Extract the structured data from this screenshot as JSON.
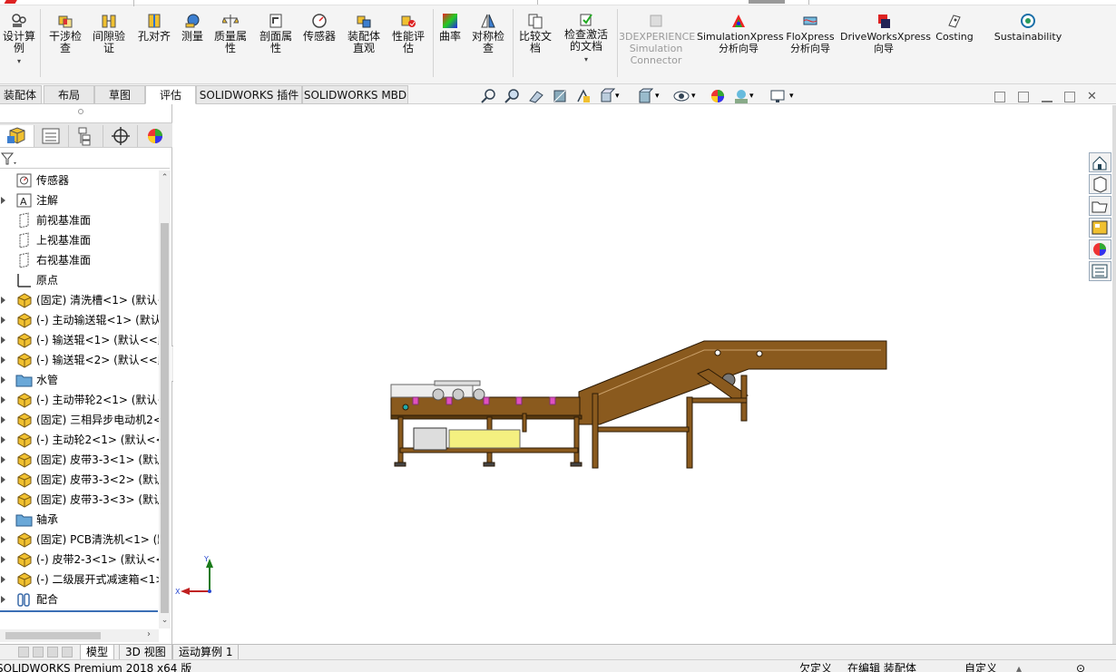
{
  "ribbon": {
    "buttons": [
      {
        "label": "设计算例",
        "icon": "design-study-icon"
      },
      {
        "label": "干涉检查",
        "icon": "interference-detection-icon"
      },
      {
        "label": "间隙验证",
        "icon": "clearance-verification-icon"
      },
      {
        "label": "孔对齐",
        "icon": "hole-alignment-icon"
      },
      {
        "label": "测量",
        "icon": "measure-icon"
      },
      {
        "label": "质量属性",
        "icon": "mass-properties-icon"
      },
      {
        "label": "剖面属性",
        "icon": "section-properties-icon"
      },
      {
        "label": "传感器",
        "icon": "sensor-icon"
      },
      {
        "label": "装配体直观",
        "icon": "assembly-visualization-icon"
      },
      {
        "label": "性能评估",
        "icon": "performance-evaluation-icon"
      },
      {
        "label": "曲率",
        "icon": "curvature-icon"
      },
      {
        "label": "对称检查",
        "icon": "symmetry-check-icon"
      },
      {
        "label": "比较文档",
        "icon": "compare-documents-icon"
      },
      {
        "label": "检查激活的文档",
        "icon": "check-active-document-icon"
      },
      {
        "label": "3DEXPERIENCE Simulation Connector",
        "icon": "3dexperience-icon"
      },
      {
        "label": "SimulationXpress 分析向导",
        "icon": "simulationxpress-icon"
      },
      {
        "label": "FloXpress 分析向导",
        "icon": "floxpress-icon"
      },
      {
        "label": "DriveWorksXpress 向导",
        "icon": "driveworksxpress-icon"
      },
      {
        "label": "Costing",
        "icon": "costing-icon"
      },
      {
        "label": "Sustainability",
        "icon": "sustainability-icon"
      }
    ]
  },
  "tabs": [
    "装配体",
    "布局",
    "草图",
    "评估",
    "SOLIDWORKS 插件",
    "SOLIDWORKS MBD"
  ],
  "active_tab": "评估",
  "tree": [
    {
      "label": "传感器",
      "icon": "sensor-icon",
      "expand": false
    },
    {
      "label": "注解",
      "icon": "annotation-icon",
      "expand": true
    },
    {
      "label": "前视基准面",
      "icon": "plane-icon",
      "expand": false
    },
    {
      "label": "上视基准面",
      "icon": "plane-icon",
      "expand": false
    },
    {
      "label": "右视基准面",
      "icon": "plane-icon",
      "expand": false
    },
    {
      "label": "原点",
      "icon": "origin-icon",
      "expand": false
    },
    {
      "label": "(固定) 清洗槽<1> (默认<",
      "icon": "subassembly-icon",
      "expand": true
    },
    {
      "label": "(-) 主动输送辊<1> (默认<",
      "icon": "subassembly-icon",
      "expand": true
    },
    {
      "label": "(-) 输送辊<1> (默认<<默",
      "icon": "subassembly-icon",
      "expand": true
    },
    {
      "label": "(-) 输送辊<2> (默认<<默",
      "icon": "subassembly-icon",
      "expand": true
    },
    {
      "label": "水管",
      "icon": "folder-icon",
      "expand": true
    },
    {
      "label": "(-) 主动带轮2<1> (默认<",
      "icon": "subassembly-icon",
      "expand": true
    },
    {
      "label": "(固定) 三相异步电动机2<",
      "icon": "subassembly-icon",
      "expand": true
    },
    {
      "label": "(-) 主动轮2<1> (默认<<",
      "icon": "subassembly-icon",
      "expand": true
    },
    {
      "label": "(固定) 皮带3-3<1> (默认",
      "icon": "subassembly-icon",
      "expand": true
    },
    {
      "label": "(固定) 皮带3-3<2> (默认",
      "icon": "subassembly-icon",
      "expand": true
    },
    {
      "label": "(固定) 皮带3-3<3> (默认",
      "icon": "subassembly-icon",
      "expand": true
    },
    {
      "label": "轴承",
      "icon": "folder-icon",
      "expand": true
    },
    {
      "label": "(固定) PCB清洗机<1> (默",
      "icon": "subassembly-icon",
      "expand": true
    },
    {
      "label": "(-) 皮带2-3<1> (默认<<",
      "icon": "subassembly-icon",
      "expand": true
    },
    {
      "label": "(-) 二级展开式减速箱<1>",
      "icon": "subassembly-icon",
      "expand": true
    },
    {
      "label": "配合",
      "icon": "mates-icon",
      "expand": true
    }
  ],
  "triad": {
    "x": "X",
    "y": "Y"
  },
  "bottom_tabs": [
    "模型",
    "3D 视图",
    "运动算例 1"
  ],
  "active_bottom_tab": "模型",
  "status": {
    "app": "SOLIDWORKS Premium 2018 x64 版",
    "defined": "欠定义",
    "editing": "在编辑 装配体",
    "custom": "自定义"
  },
  "colors": {
    "model_brown": "#8a5a1e",
    "model_outline": "#2b1a06",
    "accent_blue": "#3b6fb5"
  }
}
